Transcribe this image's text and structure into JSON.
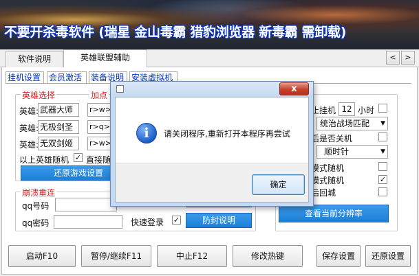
{
  "banner": {
    "title": "不要开杀毒软件 (瑞星 金山毒霸 猎豹浏览器 新毒霸 需卸载)"
  },
  "main_tabs": [
    {
      "label": "软件说明"
    },
    {
      "label": "英雄联盟辅助"
    }
  ],
  "tab_scroll": {
    "left": "<",
    "right": ">"
  },
  "sub_tabs": [
    {
      "label": "挂机设置"
    },
    {
      "label": "会员激活"
    },
    {
      "label": "装备说明"
    },
    {
      "label": "安装虚拟机"
    }
  ],
  "hero_group": {
    "legend": "英雄选择",
    "legend2": "加点",
    "rows": [
      {
        "label": "英雄:",
        "value": "武器大师",
        "skill": "r>w>q"
      },
      {
        "label": "英雄:",
        "value": "无极剑圣",
        "skill": "r>q>e"
      },
      {
        "label": "英雄:",
        "value": "无双剑姬",
        "skill": "r>w>e"
      }
    ],
    "random_label": "以上英雄随机",
    "random_checked": "✓",
    "direct_label": "直接随",
    "restore_button": "还原游戏设置"
  },
  "crash_group": {
    "legend": "崩溃重连",
    "qq_label": "qq号码",
    "qq_value": "",
    "pwd_label": "qq密码",
    "pwd_value": "",
    "quick_login_label": "快速登录",
    "quick_login_checked": "✓",
    "antiban_button": "防封说明"
  },
  "right_group": {
    "hang_label": "止挂机",
    "hang_hours": "12",
    "hours_unit": "小时",
    "match_value": "统治战场匹配",
    "shutdown_label": "后是否关机",
    "direction_value": "顺时针",
    "mode_random1": "模式随机",
    "mode_random2": "模式随机",
    "mode_random2_checked": "✓",
    "return_city": "后回城",
    "score_button": "查看当前分辨率"
  },
  "bottom_buttons": [
    {
      "label": "启动F10"
    },
    {
      "label": "暂停/继续F11"
    },
    {
      "label": "中止F12"
    },
    {
      "label": "修改热键"
    },
    {
      "label": "保存设置"
    },
    {
      "label": "还原设置"
    }
  ],
  "dialog": {
    "close": "x",
    "message": "请关闭程序,重新打开本程序再尝试",
    "ok_button": "确定",
    "info_glyph": "i"
  },
  "colors": {
    "accent_blue": "#1c7fd8",
    "legend_red": "#e81c1c",
    "subtab_blue": "#0033cc",
    "dialog_frame": "#c5d9f1"
  }
}
